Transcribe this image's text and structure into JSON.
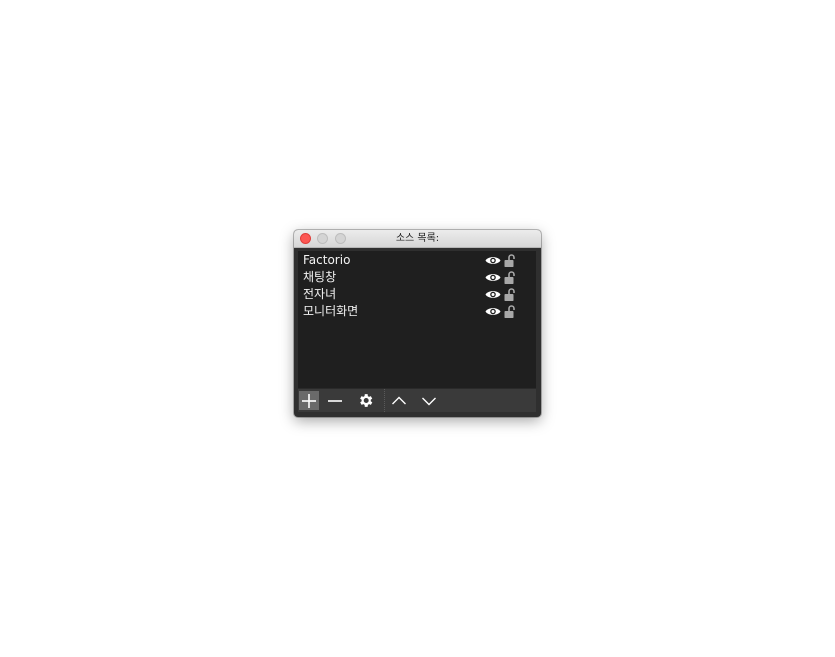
{
  "window": {
    "title": "소스 목록:"
  },
  "sources": [
    {
      "name": "Factorio",
      "visible": true,
      "locked": false
    },
    {
      "name": "채팅창",
      "visible": true,
      "locked": false
    },
    {
      "name": "전자녀",
      "visible": true,
      "locked": false
    },
    {
      "name": "모니터화면",
      "visible": true,
      "locked": false
    }
  ],
  "toolbar": {
    "buttons": [
      {
        "name": "add-source-button",
        "icon": "plus-icon"
      },
      {
        "name": "remove-source-button",
        "icon": "minus-icon"
      },
      {
        "name": "source-properties-button",
        "icon": "gear-icon"
      },
      {
        "name": "move-up-button",
        "icon": "chevron-up-icon"
      },
      {
        "name": "move-down-button",
        "icon": "chevron-down-icon"
      }
    ]
  },
  "colors": {
    "close": "#fc5753",
    "panel_bg": "#1f1f1f",
    "toolbar_bg": "#3a3a3a",
    "text": "#f2f2f2"
  }
}
